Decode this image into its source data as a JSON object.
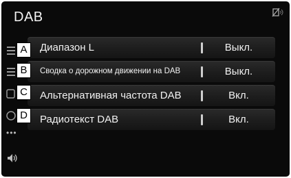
{
  "header": {
    "title": "DAB",
    "status_icon": "no-signal-icon"
  },
  "sidebar": {
    "icons": [
      "list-icon",
      "list-icon",
      "list-icon",
      "list-icon"
    ],
    "more": "•••",
    "volume_icon": "volume-icon"
  },
  "settings": [
    {
      "callout": "A",
      "label": "Диапазон L",
      "value": "Выкл."
    },
    {
      "callout": "B",
      "label": "Сводка о дорожном движении на DAB",
      "value": "Выкл."
    },
    {
      "callout": "C",
      "label": "Альтернативная частота DAB",
      "value": "Вкл."
    },
    {
      "callout": "D",
      "label": "Радиотекст DAB",
      "value": "Вкл."
    }
  ]
}
